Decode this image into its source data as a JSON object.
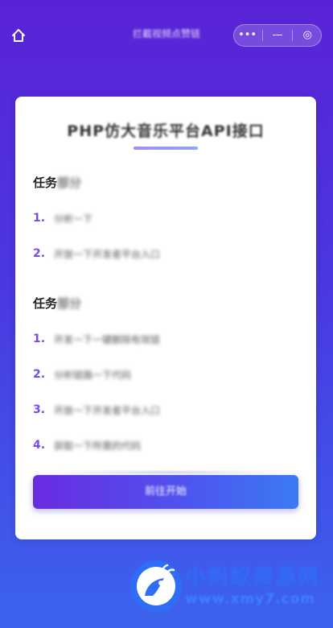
{
  "header": {
    "home_icon": "home-icon",
    "title": "拦截视频点赞链",
    "capsule": {
      "more_icon": "•••",
      "minimize_icon": "—",
      "close_icon": "◎"
    }
  },
  "card": {
    "title": "PHP仿大音乐平台API接口",
    "sections": [
      {
        "title_prefix": "任务",
        "title_blur": "部分",
        "steps": [
          {
            "num": "1.",
            "text": "分析一下"
          },
          {
            "num": "2.",
            "text": "开放一下开发者平台入口"
          }
        ]
      },
      {
        "title_prefix": "任务",
        "title_blur": "部分",
        "steps": [
          {
            "num": "1.",
            "text": "开发一下一键删除有效链"
          },
          {
            "num": "2.",
            "text": "分析链路一下代码"
          },
          {
            "num": "3.",
            "text": "开放一下开发者平台入口"
          },
          {
            "num": "4.",
            "text": "获取一下所需的代码"
          }
        ]
      }
    ],
    "button_label": "前往开始"
  },
  "watermark": {
    "name": "小蚂蚁资源网",
    "url": "www.xmy7.com"
  },
  "colors": {
    "accent": "#7a4ae6",
    "bg_top": "#5a22d6",
    "bg_bottom": "#3c63ee"
  }
}
